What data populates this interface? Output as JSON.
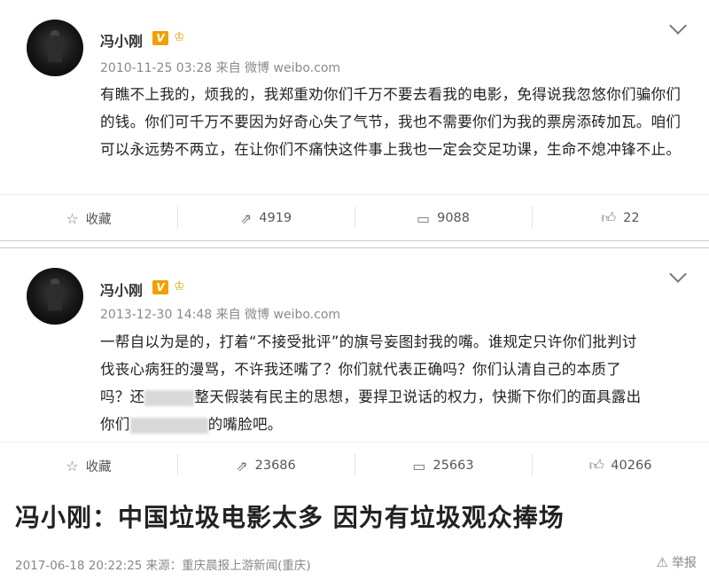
{
  "posts": [
    {
      "author": "冯小刚",
      "verified_badge": "V",
      "meta": "2010-11-25 03:28 来自 微博 weibo.com",
      "text": "有瞧不上我的，烦我的，我郑重劝你们千万不要去看我的电影，免得说我忽悠你们骗你们的钱。你们可千万不要因为好奇心失了气节，我也不需要你们为我的票房添砖加瓦。咱们可以永远势不两立，在让你们不痛快这件事上我也一定会交足功课，生命不熄冲锋不止。",
      "actions": {
        "favorite": "收藏",
        "repost": "4919",
        "comment": "9088",
        "like": "22"
      }
    },
    {
      "author": "冯小刚",
      "verified_badge": "V",
      "meta": "2013-12-30 14:48 来自 微博 weibo.com",
      "text_line1": "一帮自以为是的，打着“不接受批评”的旗号妄图封我的嘴。谁规定只许你们批判讨",
      "text_line2": "伐丧心病狂的漫骂，不许我还嘴了？你们就代表正确吗？你们认清自己的本质了",
      "text_line3a": "吗？还",
      "text_line3b": "整天假装有民主的思想，要捍卫说话的权力，快撕下你们的面具露出",
      "text_line4a": "你们",
      "text_line4b": "的嘴脸吧。",
      "actions": {
        "favorite": "收藏",
        "repost": "23686",
        "comment": "25663",
        "like": "40266"
      }
    }
  ],
  "headline": "冯小刚：中国垃圾电影太多 因为有垃圾观众捧场",
  "footer": "2017-06-18 20:22:25    来源：重庆晨报上游新闻(重庆)",
  "report": "举报",
  "icons": {
    "favorite": "star-icon",
    "repost": "repost-icon",
    "comment": "comment-icon",
    "like": "thumbs-up-icon",
    "report": "warning-icon",
    "menu": "chevron-down-icon",
    "level": "vip-crown-icon"
  }
}
